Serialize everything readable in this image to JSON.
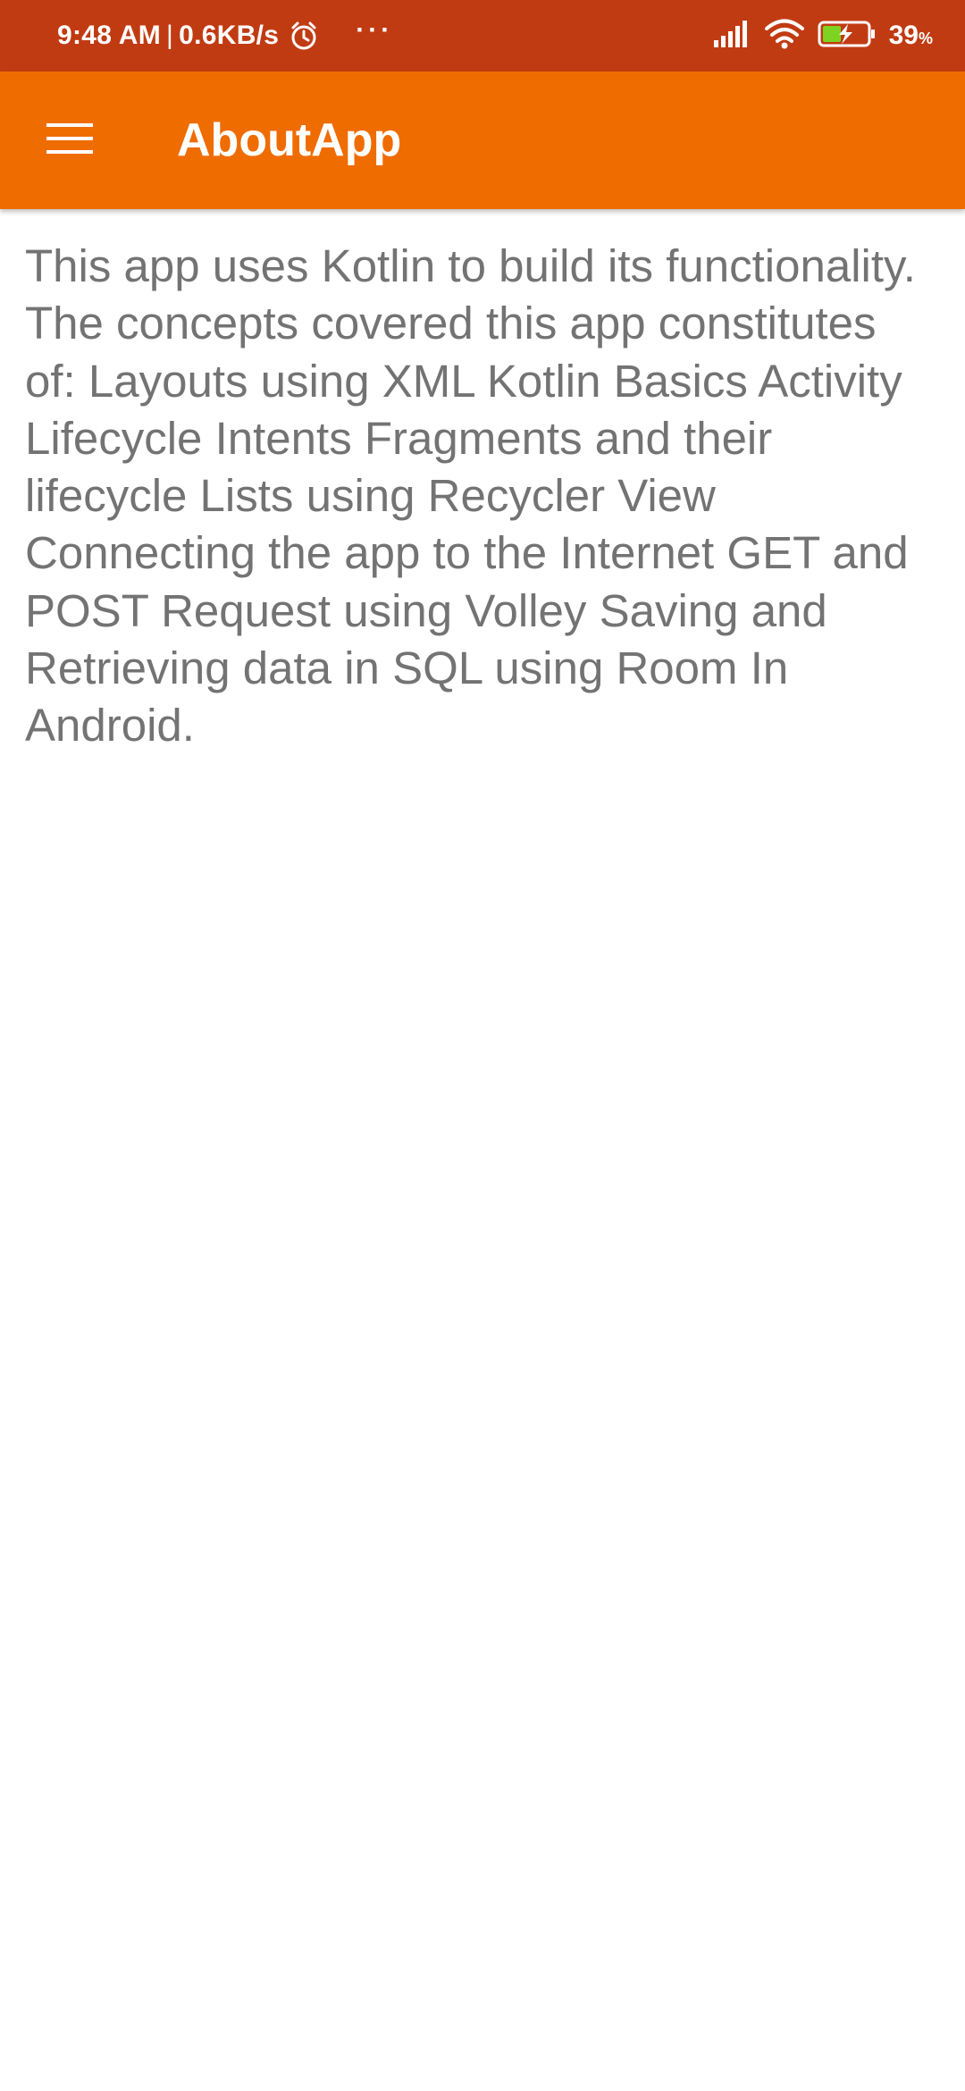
{
  "status_bar": {
    "time": "9:48 AM",
    "separator": "|",
    "network_speed": "0.6KB/s",
    "more": "···",
    "battery_percent": "39",
    "battery_unit": "%",
    "background_color": "#c13b12",
    "icons": [
      "alarm-icon",
      "signal-icon",
      "wifi-icon",
      "battery-charging-icon"
    ]
  },
  "app_bar": {
    "title": "AboutApp",
    "menu_icon": "hamburger-menu-icon",
    "background_color": "#ef6c00"
  },
  "content": {
    "text": "This app uses Kotlin to build its functionality. The concepts covered this app constitutes of: Layouts using XML Kotlin Basics Activity Lifecycle Intents Fragments and their lifecycle Lists using Recycler View Connecting the app to the Internet GET and POST Request using Volley Saving and Retrieving data in SQL using Room In Android.",
    "text_color": "#737373"
  }
}
